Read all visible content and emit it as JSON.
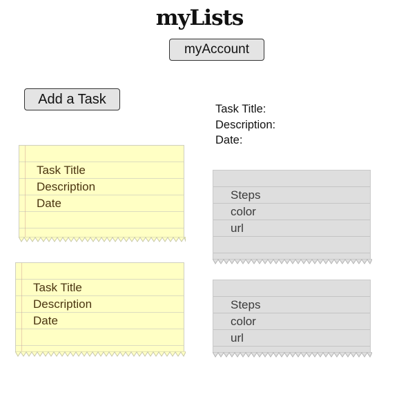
{
  "header": {
    "title": "myLists",
    "account_button": "myAccount"
  },
  "toolbar": {
    "add_task_button": "Add a Task"
  },
  "task_detail": {
    "title_label": "Task Title:",
    "description_label": "Description:",
    "date_label": "Date:"
  },
  "task_cards": [
    {
      "title": "Task Title",
      "description": "Description",
      "date": "Date"
    },
    {
      "title": "Task Title",
      "description": "Description",
      "date": "Date"
    }
  ],
  "step_cards": [
    {
      "steps": "Steps",
      "color": "color",
      "url": "url"
    },
    {
      "steps": "Steps",
      "color": "color",
      "url": "url"
    }
  ],
  "colors": {
    "task_card": "#ffffc4",
    "step_card": "#dedede"
  }
}
